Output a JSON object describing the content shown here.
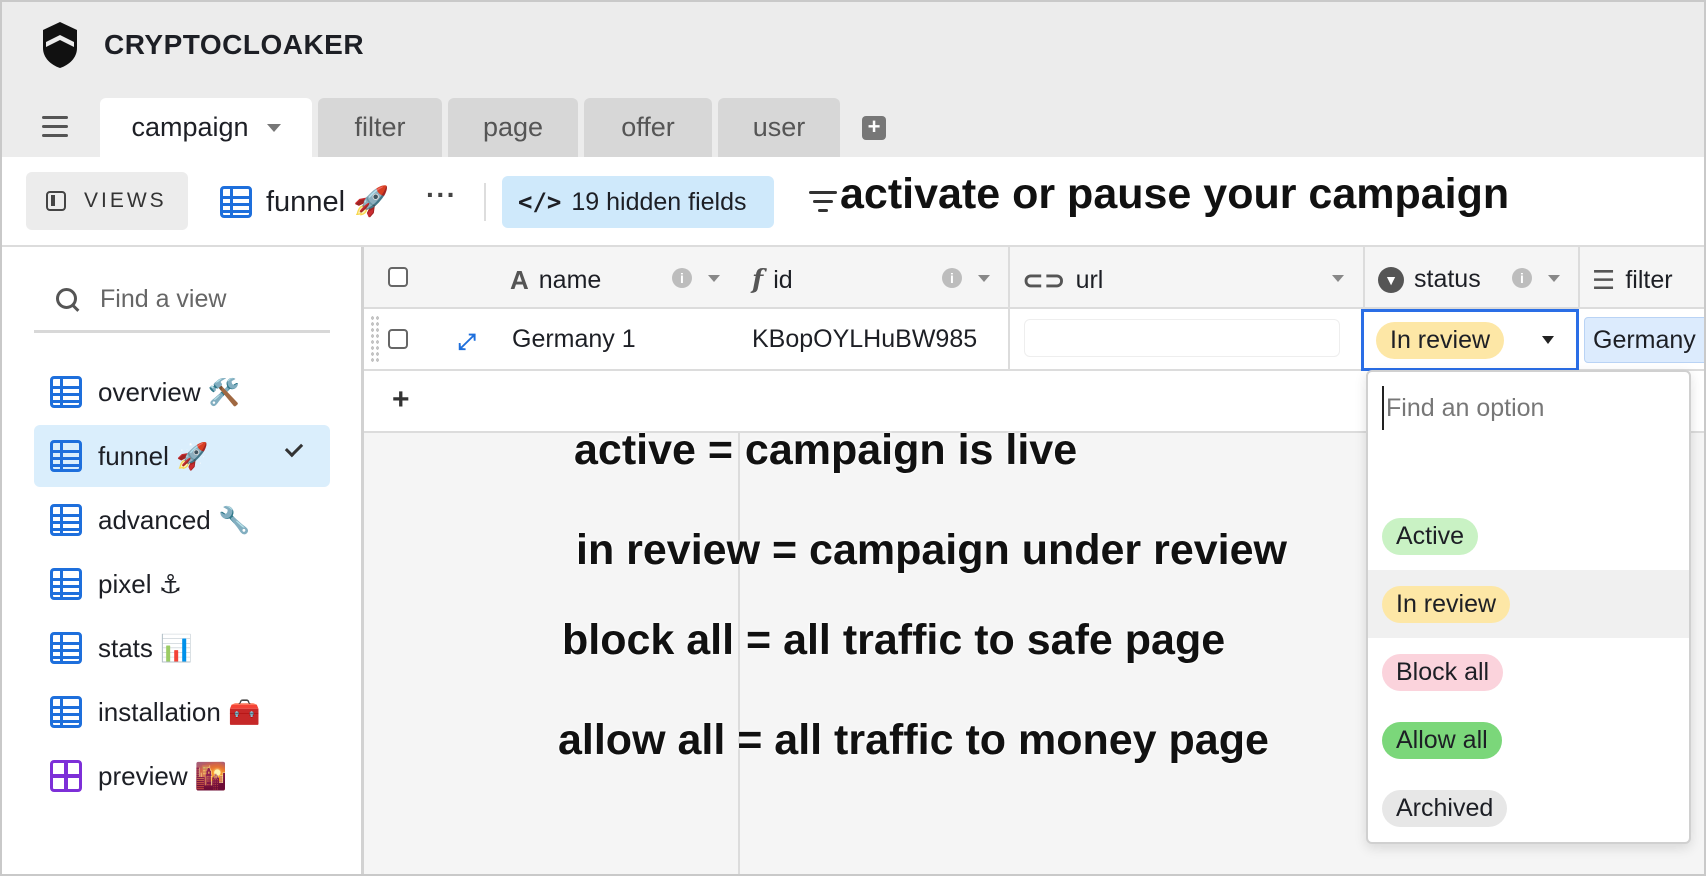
{
  "brand": {
    "name": "CRYPTOCLOAKER"
  },
  "tabs": [
    {
      "label": "campaign",
      "active": true
    },
    {
      "label": "filter"
    },
    {
      "label": "page"
    },
    {
      "label": "offer"
    },
    {
      "label": "user"
    }
  ],
  "viewbar": {
    "views_label": "VIEWS",
    "current_view": "funnel 🚀",
    "more": "···",
    "hidden_fields": "19 hidden fields"
  },
  "captions": {
    "top": "activate or pause your campaign",
    "active": "active = campaign is live",
    "in_review": "in review = campaign under review",
    "block_all": "block all = all traffic to safe page",
    "allow_all": "allow all = all traffic to money page"
  },
  "sidebar": {
    "search_placeholder": "Find a view",
    "items": [
      {
        "label": "overview 🛠️",
        "icon": "grid-icon"
      },
      {
        "label": "funnel 🚀",
        "icon": "grid-icon",
        "active": true
      },
      {
        "label": "advanced 🔧",
        "icon": "grid-icon"
      },
      {
        "label": "pixel ⚓",
        "icon": "grid-icon"
      },
      {
        "label": "stats 📊",
        "icon": "grid-icon"
      },
      {
        "label": "installation 🧰",
        "icon": "grid-icon"
      },
      {
        "label": "preview 🌇",
        "icon": "gallery-icon"
      }
    ]
  },
  "grid": {
    "columns": [
      {
        "label": "name",
        "icon": "text-field-icon"
      },
      {
        "label": "id",
        "icon": "formula-icon"
      },
      {
        "label": "url",
        "icon": "link-icon"
      },
      {
        "label": "status",
        "icon": "single-select-icon"
      },
      {
        "label": "filter",
        "icon": "linked-record-icon"
      }
    ],
    "rows": [
      {
        "name": "Germany 1",
        "id": "KBopOYLHuBW985",
        "url": "",
        "status": "In review",
        "filter": "Germany"
      }
    ],
    "add_row": "+"
  },
  "dropdown": {
    "placeholder": "Find an option",
    "options": [
      {
        "label": "Active",
        "color": "#c9f2c4"
      },
      {
        "label": "In review",
        "color": "#fde7a6",
        "hover": true
      },
      {
        "label": "Block all",
        "color": "#fbd3dc"
      },
      {
        "label": "Allow all",
        "color": "#7bd77a"
      },
      {
        "label": "Archived",
        "color": "#e7e7e7"
      }
    ]
  },
  "colors": {
    "accent": "#1e6fdc",
    "selection": "#2a6ee6",
    "active_view_bg": "#daeefc",
    "hidden_fields_bg": "#cfe9fb",
    "status_in_review": "#fde7a6"
  }
}
